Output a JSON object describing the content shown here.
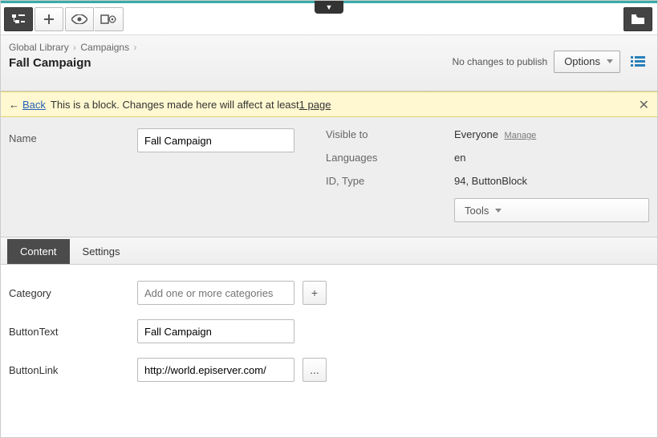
{
  "breadcrumb": [
    "Global Library",
    "Campaigns"
  ],
  "page_title": "Fall Campaign",
  "header": {
    "status": "No changes to publish",
    "options_label": "Options"
  },
  "banner": {
    "back": "Back",
    "msg_before": "This is a block. Changes made here will affect at least ",
    "pagelink": "1 page"
  },
  "props": {
    "name_label": "Name",
    "name_value": "Fall Campaign",
    "visible_label": "Visible to",
    "visible_value": "Everyone",
    "manage": "Manage",
    "lang_label": "Languages",
    "lang_value": "en",
    "idtype_label": "ID, Type",
    "idtype_value": "94, ButtonBlock",
    "tools_label": "Tools"
  },
  "tabs": {
    "content": "Content",
    "settings": "Settings"
  },
  "form": {
    "category_label": "Category",
    "category_placeholder": "Add one or more categories",
    "buttontext_label": "ButtonText",
    "buttontext_value": "Fall Campaign",
    "buttonlink_label": "ButtonLink",
    "buttonlink_value": "http://world.episerver.com/",
    "add": "+",
    "browse": "..."
  }
}
